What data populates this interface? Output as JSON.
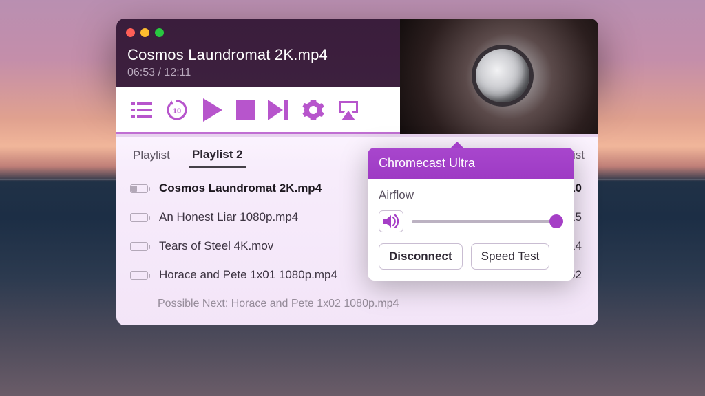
{
  "colors": {
    "accent": "#a53ec6"
  },
  "header": {
    "filename": "Cosmos Laundromat 2K.mp4",
    "position": "06:53",
    "duration": "12:11"
  },
  "toolbar": {
    "icons": {
      "playlist": "playlist-icon",
      "rewind10": "rewind-10-icon",
      "play": "play-icon",
      "stop": "stop-icon",
      "next": "next-track-icon",
      "settings": "gear-icon",
      "airplay": "airplay-icon"
    }
  },
  "tabs": {
    "items": [
      "Playlist",
      "Playlist 2"
    ],
    "active_index": 1,
    "new_label": "New Playlist"
  },
  "playlist": {
    "items": [
      {
        "title": "Cosmos Laundromat 2K.mp4",
        "duration": "12:10",
        "active": true,
        "charge": 0.35
      },
      {
        "title": "An Honest Liar 1080p.mp4",
        "duration": "01:32:15",
        "active": false,
        "charge": 0.0
      },
      {
        "title": "Tears of Steel 4K.mov",
        "duration": "12:14",
        "active": false,
        "charge": 0.0
      },
      {
        "title": "Horace and Pete 1x01 1080p.mp4",
        "duration": "01:07:52",
        "active": false,
        "charge": 0.0
      }
    ],
    "possible_next": "Possible Next: Horace and Pete 1x02 1080p.mp4"
  },
  "popover": {
    "device": "Chromecast Ultra",
    "app": "Airflow",
    "volume": 0.95,
    "disconnect_label": "Disconnect",
    "speedtest_label": "Speed Test"
  }
}
